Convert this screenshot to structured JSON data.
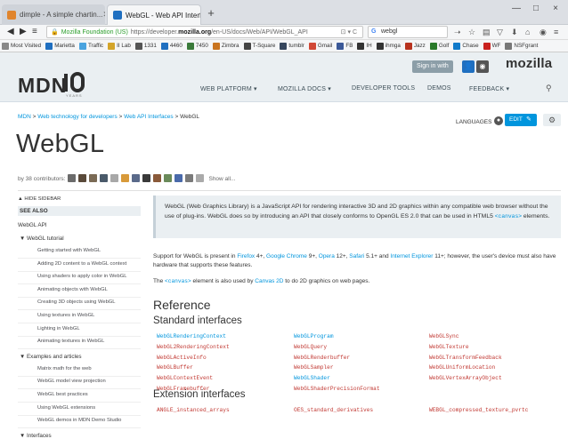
{
  "browser": {
    "tabs": [
      {
        "title": "dimple - A simple chartin...",
        "active": false,
        "icon_color": "#e0842c"
      },
      {
        "title": "WebGL - Web API Interfac...",
        "active": true,
        "icon_color": "#1f6fc0"
      }
    ],
    "new_tab_symbol": "+",
    "window_controls": [
      "—",
      "□",
      "×"
    ],
    "nav": {
      "back": "◀",
      "forward": "▶",
      "menu": "≡"
    },
    "url": {
      "organization": "Mozilla Foundation (US)",
      "prefix": "https://developer.",
      "domain": "mozilla.org",
      "path": "/en-US/docs/Web/API/WebGL_API",
      "reload": "C",
      "reader": "⊡"
    },
    "search": {
      "value": "webgl",
      "engine_icon": "G"
    },
    "toolbar_icons": [
      "star-icon",
      "clipboard-icon",
      "pocket-icon",
      "download-icon",
      "home-icon",
      "chat-icon",
      "menu-icon"
    ],
    "toolbar_glyphs": [
      "☆",
      "▤",
      "▽",
      "⬇",
      "⌂",
      "◉",
      "≡"
    ],
    "bookmarks": [
      {
        "label": "Most Visited",
        "color": "#888888"
      },
      {
        "label": "Marietta",
        "color": "#1f6fc0"
      },
      {
        "label": "Traffic",
        "color": "#4aa3df"
      },
      {
        "label": "II Lab",
        "color": "#d4a52a"
      },
      {
        "label": "1331",
        "color": "#555555"
      },
      {
        "label": "4460",
        "color": "#1f6fc0"
      },
      {
        "label": "7450",
        "color": "#3a7a3a"
      },
      {
        "label": "Zimbra",
        "color": "#c9741f"
      },
      {
        "label": "T-Square",
        "color": "#444444"
      },
      {
        "label": "tumblr",
        "color": "#36465d"
      },
      {
        "label": "Gmail",
        "color": "#d14836"
      },
      {
        "label": "FB",
        "color": "#3b5998"
      },
      {
        "label": "IH",
        "color": "#333333"
      },
      {
        "label": "ihmga",
        "color": "#333333"
      },
      {
        "label": "Jazz",
        "color": "#b8331f"
      },
      {
        "label": "Golf",
        "color": "#2a7a2a"
      },
      {
        "label": "Chase",
        "color": "#117aca"
      },
      {
        "label": "WF",
        "color": "#c9211e"
      },
      {
        "label": "NSFgrant",
        "color": "#777777"
      }
    ]
  },
  "header": {
    "sign_in": "Sign in with",
    "sso_colors": [
      "#1f6fc0",
      "#555555"
    ],
    "mozilla": "mozilla",
    "logo": "MDN",
    "logo_years": "YEARS",
    "nav": [
      {
        "label": "WEB PLATFORM ▾"
      },
      {
        "label": "MOZILLA DOCS ▾"
      },
      {
        "label": "DEVELOPER TOOLS"
      },
      {
        "label": "DEMOS"
      },
      {
        "label": "FEEDBACK ▾"
      }
    ],
    "search_icon": "⚲"
  },
  "breadcrumb": [
    "MDN",
    "Web technology for developers",
    "Web API Interfaces",
    "WebGL"
  ],
  "breadcrumb_sep": ">",
  "languages": "LANGUAGES",
  "edit": "EDIT",
  "page_title": "WebGL",
  "contributors": {
    "text": "by 38 contributors:",
    "show_all": "Show all...",
    "avatar_colors": [
      "#6b6b6b",
      "#5a4a3a",
      "#7a6a55",
      "#4a5a6a",
      "#a8a8a8",
      "#d89a3a",
      "#5a6a8a",
      "#3a3a3a",
      "#8a5a3a",
      "#6a8a5a",
      "#4a6aaa",
      "#7a7a7a",
      "#aaaaaa"
    ]
  },
  "sidebar": {
    "hide": "▲ HIDE SIDEBAR",
    "see_also": "SEE ALSO",
    "api": "WebGL API",
    "groups": [
      {
        "label": "▼ WebGL tutorial",
        "items": [
          "Getting started with WebGL",
          "Adding 2D content to a WebGL context",
          "Using shaders to apply color in WebGL",
          "Animating objects with WebGL",
          "Creating 3D objects using WebGL",
          "Using textures in WebGL",
          "Lighting in WebGL",
          "Animating textures in WebGL"
        ]
      },
      {
        "label": "▼ Examples and articles",
        "items": [
          "Matrix math for the web",
          "WebGL model view projection",
          "WebGL best practices",
          "Using WebGL extensions",
          "WebGL demos in MDN Demo Studio"
        ]
      },
      {
        "label": "▼ Interfaces",
        "items": []
      }
    ]
  },
  "summary": {
    "text1": "WebGL (Web Graphics Library) is a JavaScript API for rendering interactive 3D and 2D graphics within any compatible web browser without the use of plug-ins. WebGL does so by introducing an API that closely conforms to OpenGL ES 2.0 that can be used in HTML5 ",
    "code": "<canvas>",
    "text2": " elements."
  },
  "support": {
    "t1": "Support for WebGL is present in ",
    "firefox": "Firefox",
    "t2": " 4+, ",
    "chrome": "Google Chrome",
    "t3": " 9+, ",
    "opera": "Opera",
    "t4": " 12+, ",
    "safari": "Safari",
    "t5": " 5.1+ and ",
    "ie": "Internet Explorer",
    "t6": " 11+; however, the user's device must also have hardware that supports these features."
  },
  "canvas_note": {
    "t1": "The ",
    "code": "<canvas>",
    "t2": " element is also used by ",
    "link": "Canvas 2D",
    "t3": " to do 2D graphics on web pages."
  },
  "reference": "Reference",
  "standard_interfaces": "Standard interfaces",
  "standard": [
    [
      {
        "name": "WebGLRenderingContext",
        "color": "blue"
      },
      {
        "name": "WebGL2RenderingContext",
        "color": "red"
      },
      {
        "name": "WebGLActiveInfo",
        "color": "red"
      },
      {
        "name": "WebGLBuffer",
        "color": "red"
      },
      {
        "name": "WebGLContextEvent",
        "color": "red"
      },
      {
        "name": "WebGLFramebuffer",
        "color": "red"
      }
    ],
    [
      {
        "name": "WebGLProgram",
        "color": "blue"
      },
      {
        "name": "WebGLQuery",
        "color": "red"
      },
      {
        "name": "WebGLRenderbuffer",
        "color": "red"
      },
      {
        "name": "WebGLSampler",
        "color": "red"
      },
      {
        "name": "WebGLShader",
        "color": "blue"
      },
      {
        "name": "WebGLShaderPrecisionFormat",
        "color": "red"
      }
    ],
    [
      {
        "name": "WebGLSync",
        "color": "red"
      },
      {
        "name": "WebGLTexture",
        "color": "red"
      },
      {
        "name": "WebGLTransformFeedback",
        "color": "red"
      },
      {
        "name": "WebGLUniformLocation",
        "color": "red"
      },
      {
        "name": "WebGLVertexArrayObject",
        "color": "red"
      }
    ]
  ],
  "extension_interfaces": "Extension interfaces",
  "extensions": [
    {
      "name": "ANGLE_instanced_arrays",
      "color": "red"
    },
    {
      "name": "OES_standard_derivatives",
      "color": "red"
    },
    {
      "name": "WEBGL_compressed_texture_pvrtc",
      "color": "red"
    }
  ]
}
